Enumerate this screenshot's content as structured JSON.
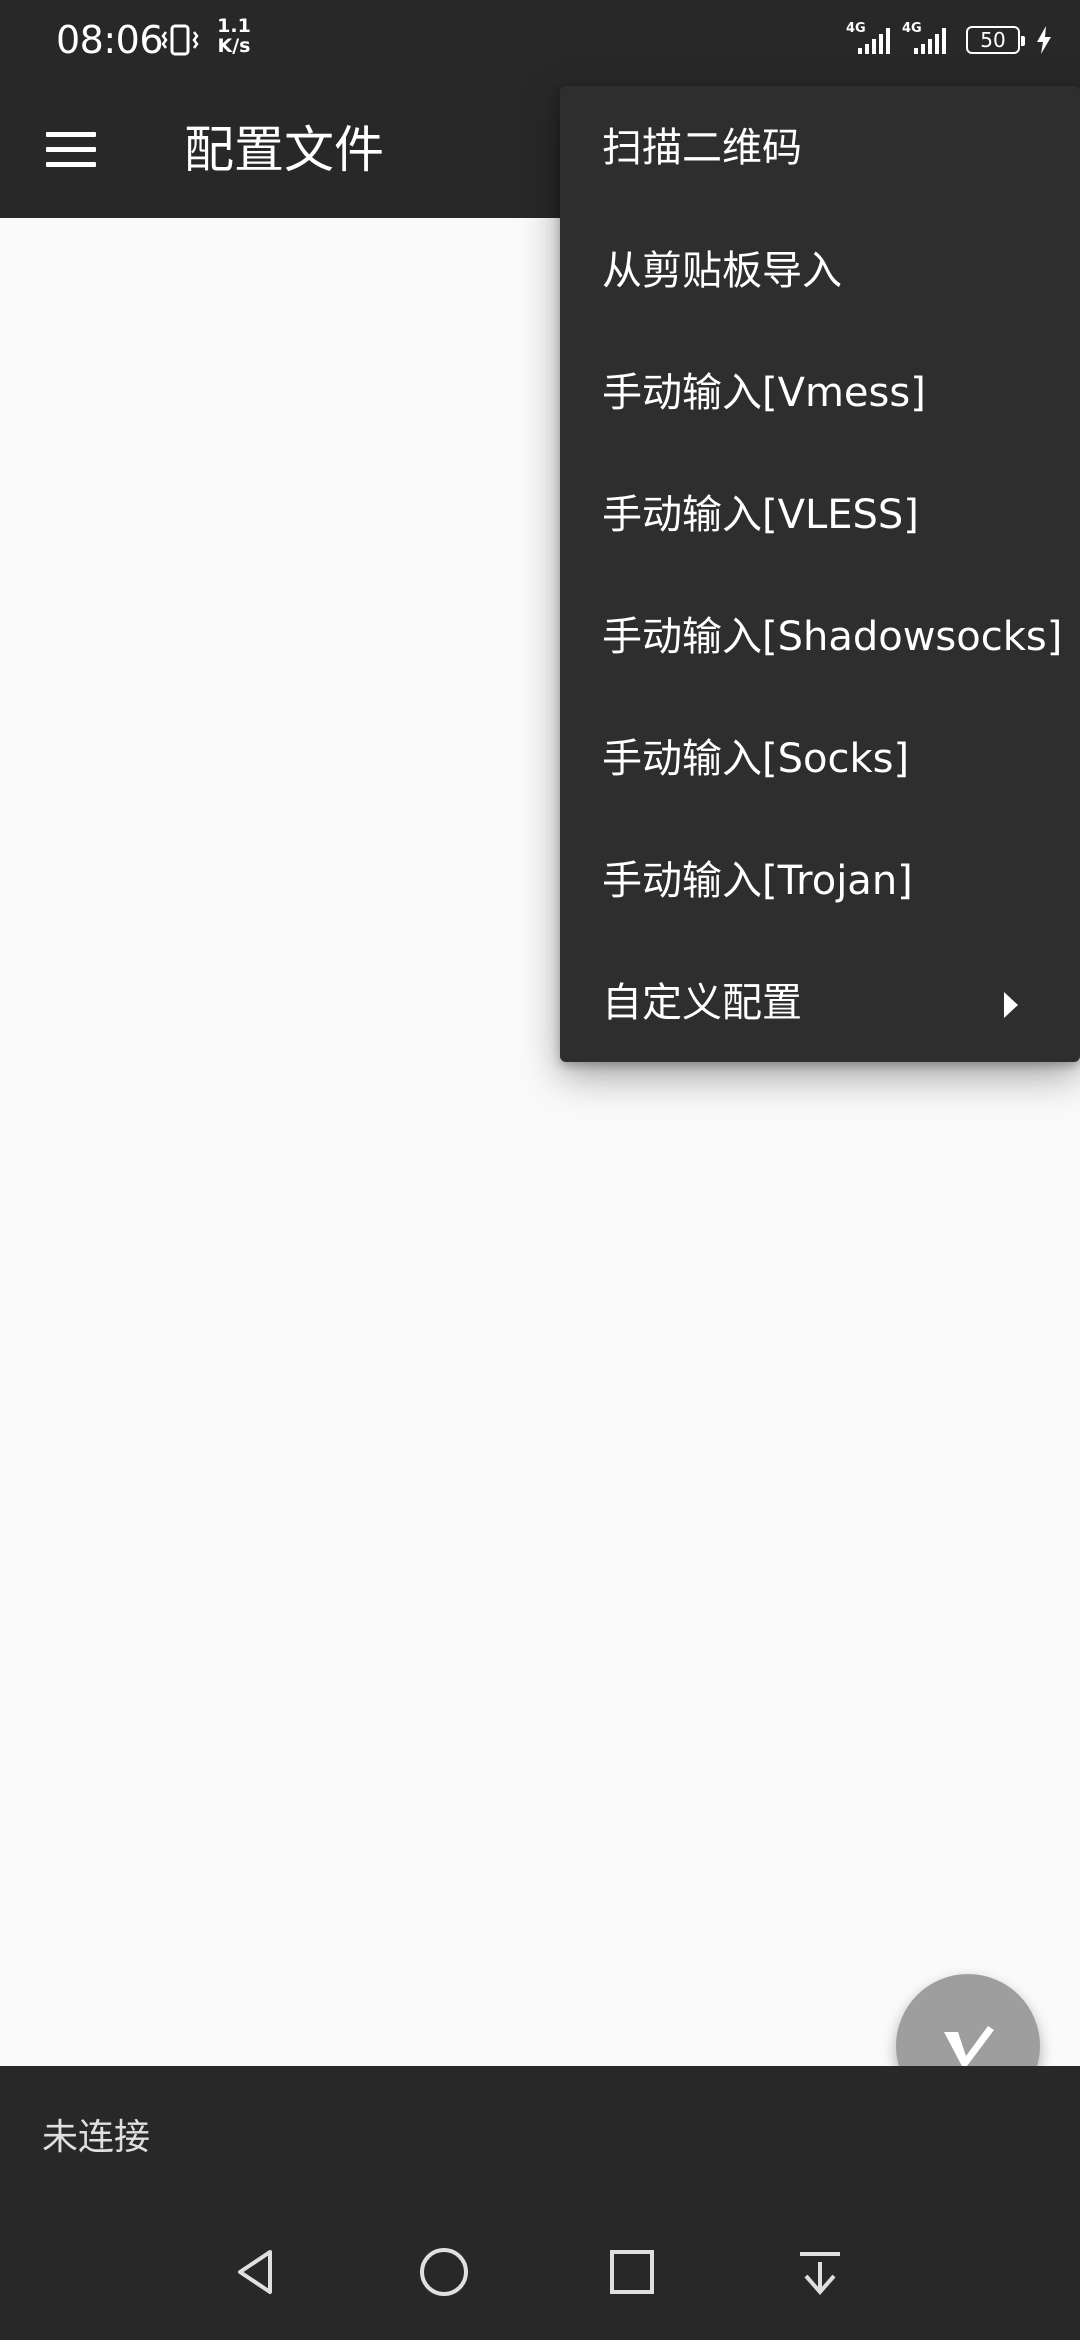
{
  "status_bar": {
    "time": "08:06",
    "net_speed_value": "1.1",
    "net_speed_unit": "K/s",
    "sim1_tech": "4G",
    "sim2_tech": "4G",
    "battery_level": "50",
    "icons": [
      "vibrate-icon",
      "signal-icon",
      "signal-icon",
      "battery-icon",
      "charging-bolt-icon"
    ]
  },
  "toolbar": {
    "title": "配置文件",
    "menu_icon": "hamburger-menu-icon"
  },
  "popup_menu": {
    "items": [
      {
        "label": "扫描二维码"
      },
      {
        "label": "从剪贴板导入"
      },
      {
        "label": "手动输入[Vmess]"
      },
      {
        "label": "手动输入[VLESS]"
      },
      {
        "label": "手动输入[Shadowsocks]"
      },
      {
        "label": "手动输入[Socks]"
      },
      {
        "label": "手动输入[Trojan]"
      },
      {
        "label": "自定义配置",
        "has_submenu": true
      }
    ]
  },
  "fab": {
    "icon": "v-logo-icon",
    "color": "#9e9e9e"
  },
  "bottom_panel": {
    "connection_status": "未连接"
  },
  "nav_bar": {
    "icons": [
      "back-icon",
      "home-icon",
      "recents-icon",
      "notification-pull-icon"
    ]
  },
  "colors": {
    "bar_background": "#282828",
    "menu_background": "#2e2e2e",
    "content_background": "#fafafa"
  }
}
